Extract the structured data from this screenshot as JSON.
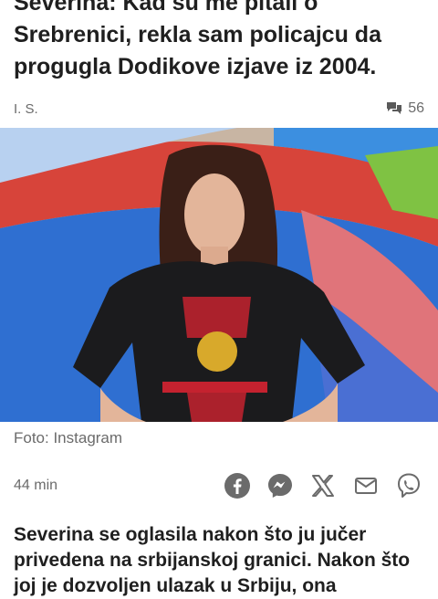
{
  "article": {
    "headline": "Severina: Kad su me pitali o Srebrenici, rekla sam policajcu da progugla Dodikove izjave iz 2004.",
    "author": "I. S.",
    "comment_count": "56",
    "photo_caption": "Foto: Instagram",
    "time_ago": "44 min",
    "lead": "Severina se oglasila nakon što ju jučer privedena na srbijanskoj granici. Nakon što joj je dozvoljen ulazak u Srbiju, ona"
  },
  "icons": {
    "comments": "comments-icon",
    "share": [
      "facebook-icon",
      "messenger-icon",
      "x-icon",
      "mail-icon",
      "viber-icon"
    ]
  },
  "colors": {
    "icon_gray": "#6b6b6b",
    "text": "#1f1f1f",
    "muted": "#6b6b6b"
  }
}
